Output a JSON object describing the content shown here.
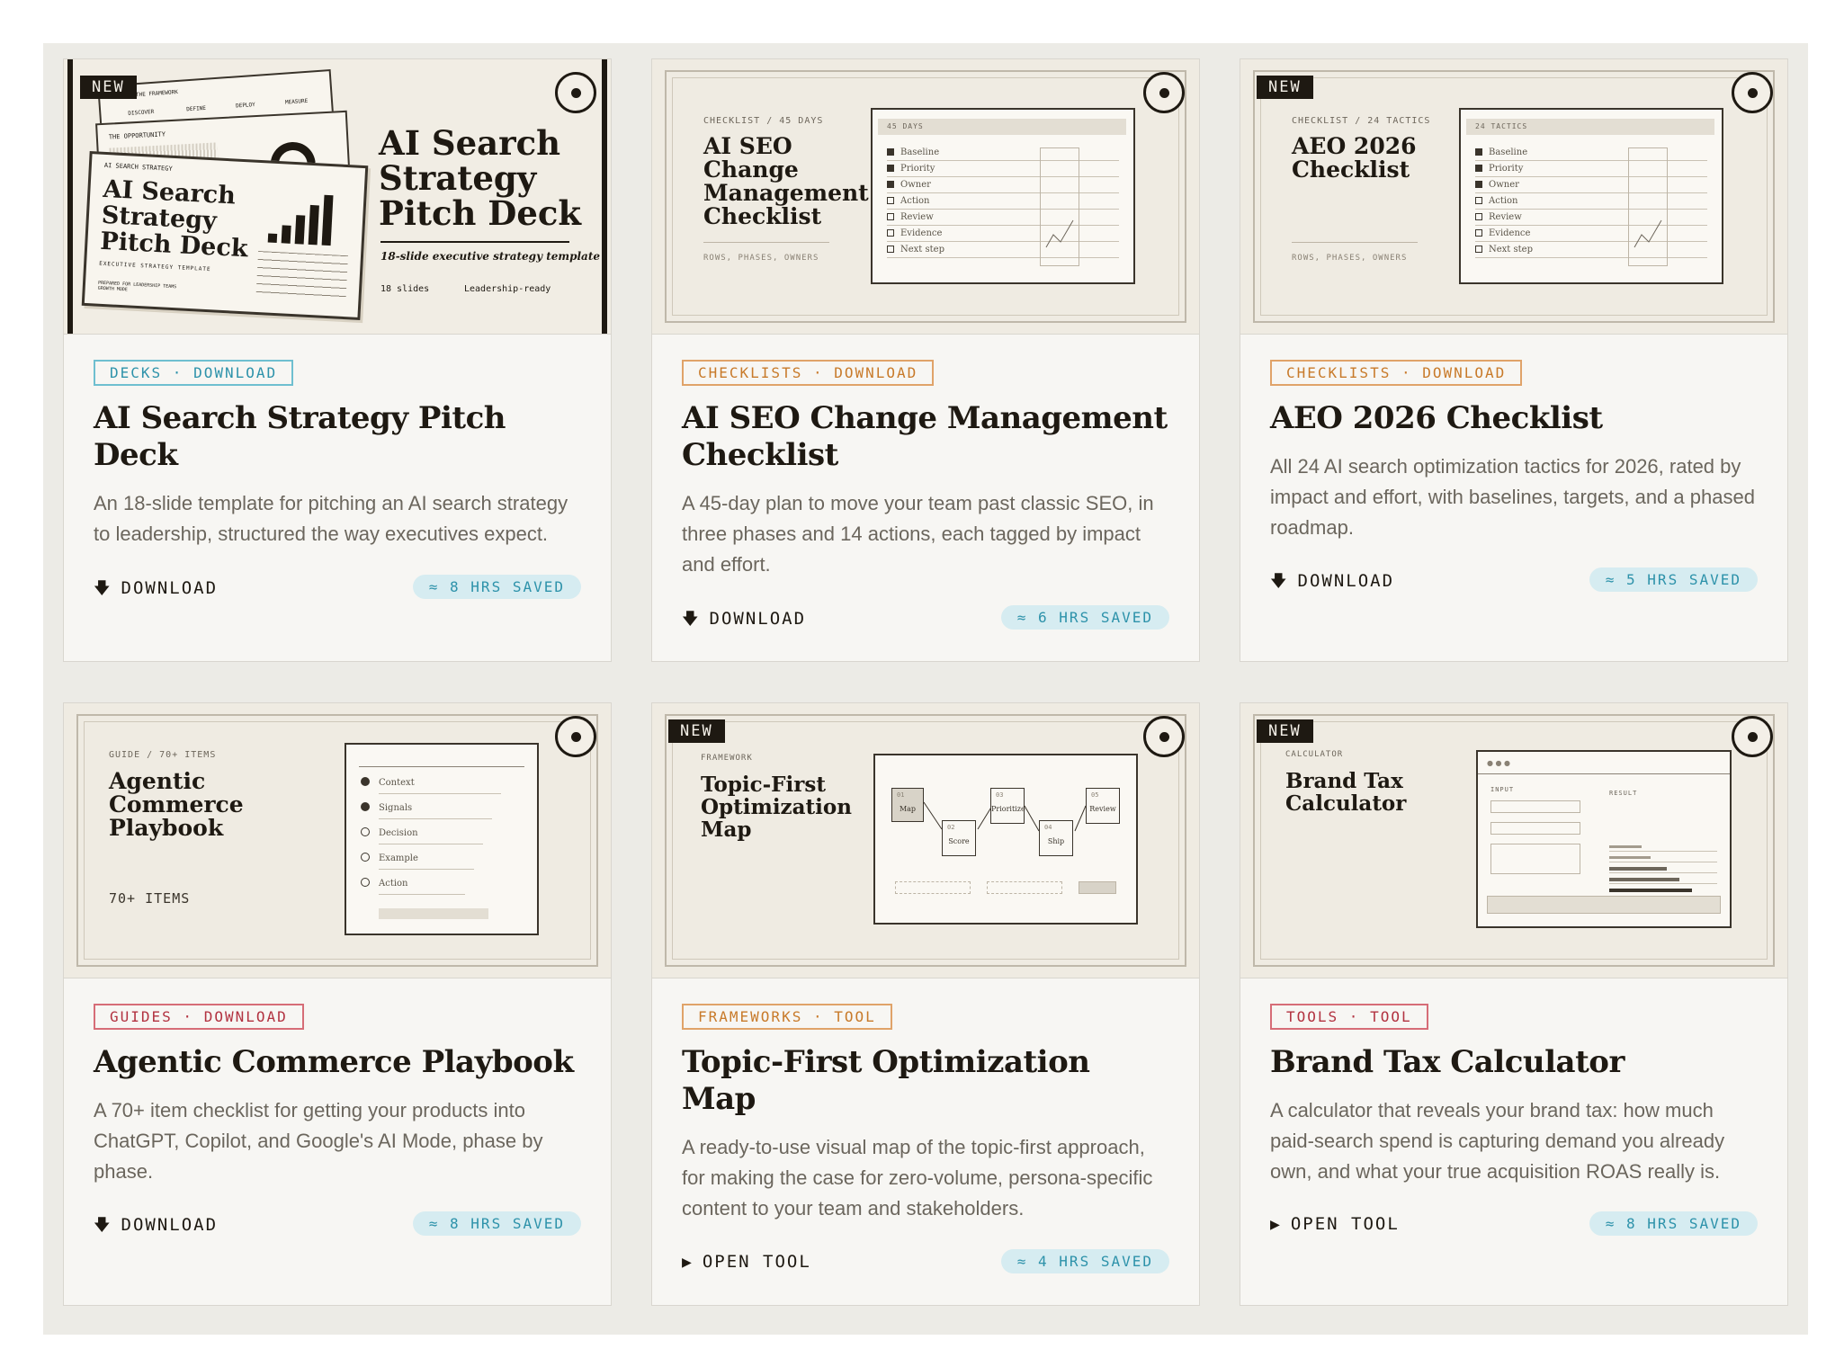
{
  "cards": [
    {
      "preview": {
        "new_badge": "NEW",
        "title_lines": [
          "AI Search",
          "Strategy",
          "Pitch Deck"
        ],
        "subtitle": "18-slide executive strategy template",
        "meta_left": "18 slides",
        "meta_right": "Leadership-ready",
        "slide_title_lines": [
          "AI Search",
          "Strategy",
          "Pitch Deck"
        ],
        "slide_caption": "EXECUTIVE STRATEGY TEMPLATE",
        "slide_note_lines": [
          "PREPARED FOR LEADERSHIP TEAMS",
          "GROWTH MODE"
        ],
        "slide_header_mid": "THE OPPORTUNITY",
        "slide_header_small": "AI SEARCH STRATEGY",
        "slide_header_back": "THE FRAMEWORK",
        "slide_back_steps": [
          "DISCOVER",
          "DEFINE",
          "DEPLOY",
          "MEASURE"
        ]
      },
      "tag": "DECKS · DOWNLOAD",
      "tag_color": "#2d92aa",
      "title": "AI Search Strategy Pitch Deck",
      "description": "An 18-slide template for pitching an AI search strategy to leadership, structured the way executives expect.",
      "action": "DOWNLOAD",
      "action_icon": "download-arrow-icon",
      "saved": "≈ 8 HRS SAVED"
    },
    {
      "preview": {
        "eyebrow": "CHECKLIST / 45 DAYS",
        "title_lines": [
          "AI SEO",
          "Change",
          "Management",
          "Checklist"
        ],
        "footer": "ROWS, PHASES, OWNERS",
        "sheet_header": "45 DAYS",
        "items": [
          "Baseline",
          "Priority",
          "Owner",
          "Action",
          "Review",
          "Evidence",
          "Next step"
        ]
      },
      "tag": "CHECKLISTS · DOWNLOAD",
      "tag_color": "#c87a2a",
      "title": "AI SEO Change Management Checklist",
      "description": "A 45-day plan to move your team past classic SEO, in three phases and 14 actions, each tagged by impact and effort.",
      "action": "DOWNLOAD",
      "action_icon": "download-arrow-icon",
      "saved": "≈ 6 HRS SAVED"
    },
    {
      "preview": {
        "new_badge": "NEW",
        "eyebrow": "CHECKLIST / 24 TACTICS",
        "title_lines": [
          "AEO 2026",
          "Checklist"
        ],
        "footer": "ROWS, PHASES, OWNERS",
        "sheet_header": "24 TACTICS",
        "items": [
          "Baseline",
          "Priority",
          "Owner",
          "Action",
          "Review",
          "Evidence",
          "Next step"
        ]
      },
      "tag": "CHECKLISTS · DOWNLOAD",
      "tag_color": "#c87a2a",
      "title": "AEO 2026 Checklist",
      "description": "All 24 AI search optimization tactics for 2026, rated by impact and effort, with baselines, targets, and a phased roadmap.",
      "action": "DOWNLOAD",
      "action_icon": "download-arrow-icon",
      "saved": "≈ 5 HRS SAVED"
    },
    {
      "preview": {
        "eyebrow": "GUIDE / 70+ ITEMS",
        "title_lines": [
          "Agentic",
          "Commerce",
          "Playbook"
        ],
        "footer": "70+ ITEMS",
        "items": [
          "Context",
          "Signals",
          "Decision",
          "Example",
          "Action"
        ]
      },
      "tag": "GUIDES · DOWNLOAD",
      "tag_color": "#b23240",
      "title": "Agentic Commerce Playbook",
      "description": "A 70+ item checklist for getting your products into ChatGPT, Copilot, and Google's AI Mode, phase by phase.",
      "action": "DOWNLOAD",
      "action_icon": "download-arrow-icon",
      "saved": "≈ 8 HRS SAVED"
    },
    {
      "preview": {
        "new_badge": "NEW",
        "eyebrow": "FRAMEWORK",
        "title_lines": [
          "Topic-First",
          "Optimization",
          "Map"
        ],
        "nodes": [
          {
            "num": "01",
            "label": "Map"
          },
          {
            "num": "02",
            "label": "Score"
          },
          {
            "num": "03",
            "label": "Prioritize"
          },
          {
            "num": "04",
            "label": "Ship"
          },
          {
            "num": "05",
            "label": "Review"
          }
        ]
      },
      "tag": "FRAMEWORKS · TOOL",
      "tag_color": "#c87a2a",
      "title": "Topic-First Optimization Map",
      "description": "A ready-to-use visual map of the topic-first approach, for making the case for zero-volume, persona-specific content to your team and stakeholders.",
      "action": "OPEN TOOL",
      "action_icon": "play-triangle-icon",
      "saved": "≈ 4 HRS SAVED"
    },
    {
      "preview": {
        "new_badge": "NEW",
        "eyebrow": "CALCULATOR",
        "title_lines": [
          "Brand Tax",
          "Calculator"
        ],
        "input_label": "INPUT",
        "result_label": "RESULT"
      },
      "tag": "TOOLS · TOOL",
      "tag_color": "#b23240",
      "title": "Brand Tax Calculator",
      "description": "A calculator that reveals your brand tax: how much paid-search spend is capturing demand you already own, and what your true acquisition ROAS really is.",
      "action": "OPEN TOOL",
      "action_icon": "play-triangle-icon",
      "saved": "≈ 8 HRS SAVED"
    }
  ]
}
